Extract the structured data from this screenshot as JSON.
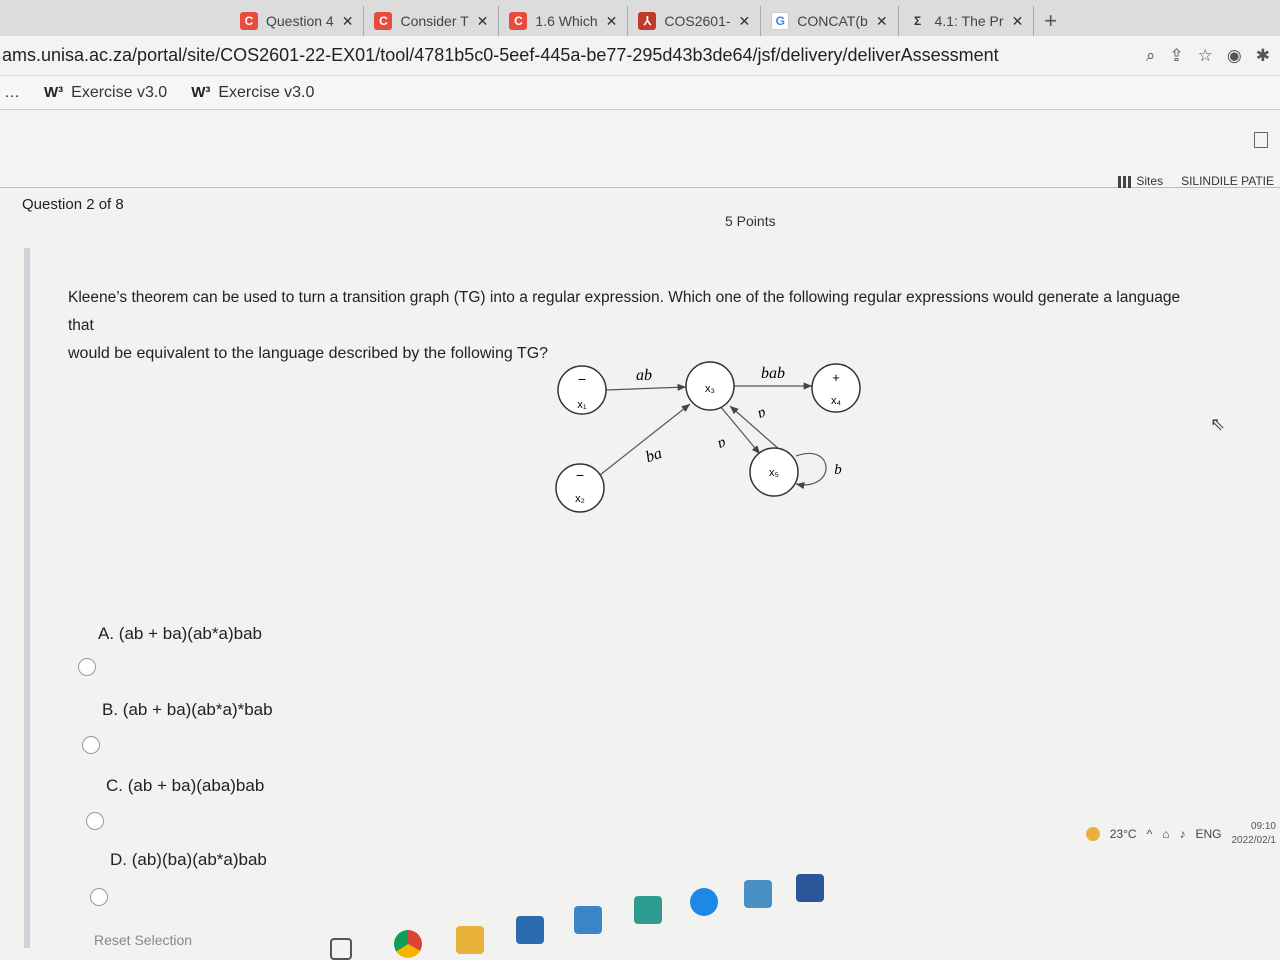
{
  "tabs": [
    {
      "label": "Question 4",
      "icon": "c-icon",
      "color": "#e74c3c"
    },
    {
      "label": "Consider T",
      "icon": "c-icon",
      "color": "#e74c3c"
    },
    {
      "label": "1.6 Which",
      "icon": "c-icon",
      "color": "#e74c3c"
    },
    {
      "label": "COS2601-",
      "icon": "pdf-icon",
      "color": "#c0392b"
    },
    {
      "label": "CONCAT(b",
      "icon": "g-icon",
      "color": "#4285f4"
    },
    {
      "label": "4.1: The Pr",
      "icon": "sigma-icon",
      "color": "#333333"
    }
  ],
  "address": {
    "url": "ams.unisa.ac.za/portal/site/COS2601-22-EX01/tool/4781b5c0-5eef-445a-be77-295d43b3de64/jsf/delivery/deliverAssessment"
  },
  "bookmarks": [
    {
      "label": "Exercise v3.0"
    },
    {
      "label": "Exercise v3.0"
    }
  ],
  "portal": {
    "sites_label": "Sites",
    "user_label": "SILINDILE PATIE"
  },
  "question": {
    "header": "Question 2 of 8",
    "points": "5 Points",
    "text_line1": "Kleene’s theorem can be used to turn a transition graph (TG) into a regular expression. Which one of the following regular expressions would generate a language that",
    "text_line2": "would be equivalent to the language described by the following TG?"
  },
  "graph": {
    "states": [
      {
        "name": "x1",
        "label": "x₁",
        "mark": "−"
      },
      {
        "name": "x2",
        "label": "x₂",
        "mark": "−"
      },
      {
        "name": "x3",
        "label": "x₃",
        "mark": ""
      },
      {
        "name": "x4",
        "label": "x₄",
        "mark": "+"
      },
      {
        "name": "x5",
        "label": "x₅",
        "mark": ""
      }
    ],
    "edges": [
      {
        "from": "x1",
        "to": "x3",
        "label": "ab"
      },
      {
        "from": "x2",
        "to": "x3",
        "label": "ba"
      },
      {
        "from": "x3",
        "to": "x4",
        "label": "bab"
      },
      {
        "from": "x3",
        "to": "x5",
        "label": "a"
      },
      {
        "from": "x5",
        "to": "x3",
        "label": "a"
      },
      {
        "from": "x5",
        "to": "x5",
        "label": "b"
      }
    ]
  },
  "options": [
    {
      "letter": "A.",
      "text": "(ab + ba)(ab*a)bab"
    },
    {
      "letter": "B.",
      "text": "(ab + ba)(ab*a)*bab"
    },
    {
      "letter": "C.",
      "text": "(ab + ba)(aba)bab"
    },
    {
      "letter": "D.",
      "text": "(ab)(ba)(ab*a)bab"
    }
  ],
  "reset_label": "Reset Selection",
  "tray": {
    "temperature": "23°C",
    "language": "ENG",
    "time": "09:10",
    "date": "2022/02/1"
  }
}
